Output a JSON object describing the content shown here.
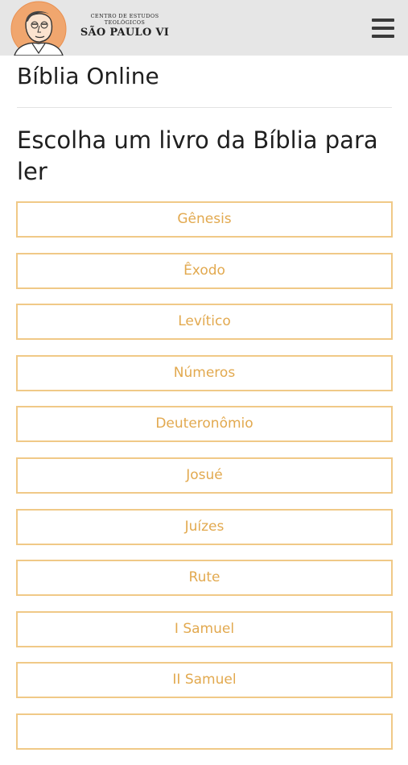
{
  "header": {
    "logo_line1": "CENTRO DE ESTUDOS",
    "logo_line2": "TEOLÓGICOS",
    "logo_line3": "SÃO PAULO VI",
    "menu_icon": "hamburger-menu-icon",
    "background_color": "#e6e6e6"
  },
  "main": {
    "page_title": "Bíblia Online",
    "subheading": "Escolha um livro da Bíblia para ler",
    "accent_color": "#e2a94f",
    "border_color": "#f0c987",
    "books": [
      "Gênesis",
      "Êxodo",
      "Levítico",
      "Números",
      "Deuteronômio",
      "Josué",
      "Juízes",
      "Rute",
      "I Samuel",
      "II Samuel",
      ""
    ]
  }
}
